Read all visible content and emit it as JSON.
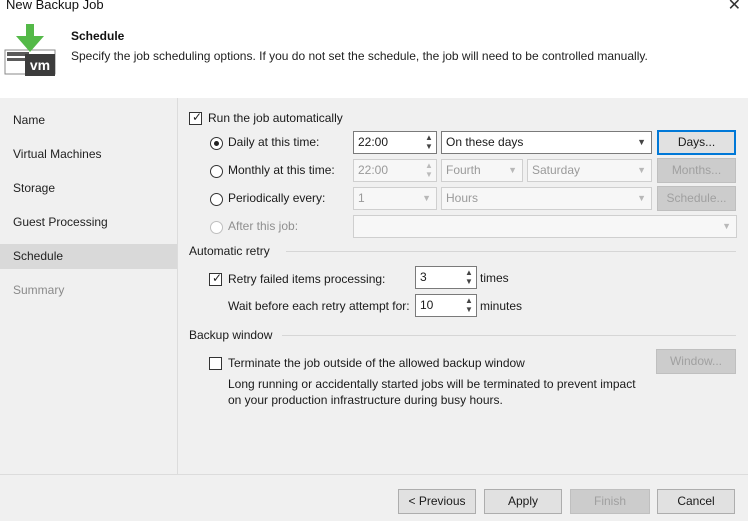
{
  "window": {
    "title": "New Backup Job",
    "close_icon": "close-icon"
  },
  "header": {
    "title": "Schedule",
    "description": "Specify the job scheduling options. If you do not set the schedule, the job will need to be controlled manually.",
    "icon_text": "vm"
  },
  "sidebar": {
    "items": [
      {
        "label": "Name"
      },
      {
        "label": "Virtual Machines"
      },
      {
        "label": "Storage"
      },
      {
        "label": "Guest Processing"
      },
      {
        "label": "Schedule"
      },
      {
        "label": "Summary"
      }
    ]
  },
  "schedule": {
    "run_auto": {
      "label": "Run the job automatically",
      "checked": true
    },
    "daily": {
      "label": "Daily at this time:",
      "time": "22:00",
      "days_option": "On these days",
      "button": "Days..."
    },
    "monthly": {
      "label": "Monthly at this time:",
      "time": "22:00",
      "week": "Fourth",
      "day": "Saturday",
      "button": "Months..."
    },
    "periodic": {
      "label": "Periodically every:",
      "value": "1",
      "unit": "Hours",
      "button": "Schedule..."
    },
    "after": {
      "label": "After this job:",
      "value": ""
    }
  },
  "retry": {
    "section": "Automatic retry",
    "retry_label": "Retry failed items processing:",
    "retry_value": "3",
    "retry_unit": "times",
    "wait_label": "Wait before each retry attempt for:",
    "wait_value": "10",
    "wait_unit": "minutes"
  },
  "backup_window": {
    "section": "Backup window",
    "terminate_label": "Terminate the job outside of the allowed backup window",
    "note_line1": "Long running or accidentally started jobs will be terminated to prevent impact",
    "note_line2": "on your production infrastructure during busy hours.",
    "button": "Window..."
  },
  "footer": {
    "previous": "< Previous",
    "apply": "Apply",
    "finish": "Finish",
    "cancel": "Cancel"
  }
}
